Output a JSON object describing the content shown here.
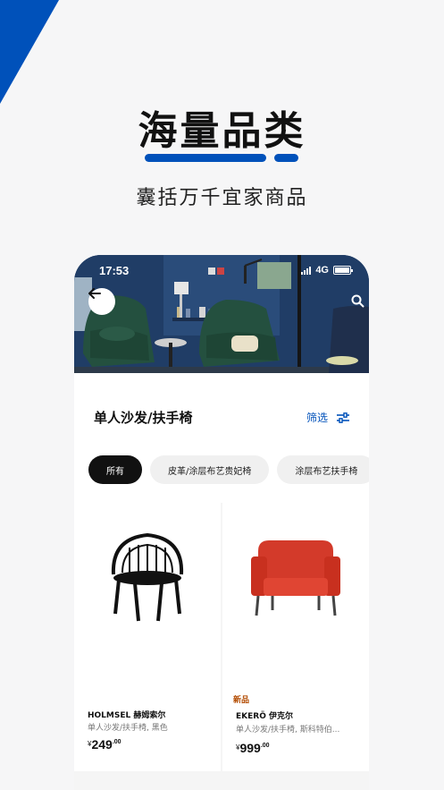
{
  "headline": "海量品类",
  "subheadline": "囊括万千宜家商品",
  "colors": {
    "brand_blue": "#0051ba",
    "new_badge": "#b34b00"
  },
  "status_bar": {
    "time": "17:53",
    "network": "4G"
  },
  "category": {
    "title": "单人沙发/扶手椅",
    "filter_label": "筛选"
  },
  "chips": [
    {
      "label": "所有",
      "active": true
    },
    {
      "label": "皮革/涂层布艺贵妃椅",
      "active": false
    },
    {
      "label": "涂层布艺扶手椅",
      "active": false
    }
  ],
  "products": [
    {
      "badge": "",
      "name": "HOLMSEL 赫姆索尔",
      "desc": "单人沙发/扶手椅, 黑色",
      "currency": "¥",
      "price_int": "249",
      "price_dec": ".00"
    },
    {
      "badge": "新品",
      "name": "EKERÖ 伊克尔",
      "desc": "单人沙发/扶手椅, 斯科特伯...",
      "currency": "¥",
      "price_int": "999",
      "price_dec": ".00"
    }
  ],
  "icons": {
    "back": "arrow-left-icon",
    "search": "search-icon",
    "filter": "sliders-icon"
  }
}
